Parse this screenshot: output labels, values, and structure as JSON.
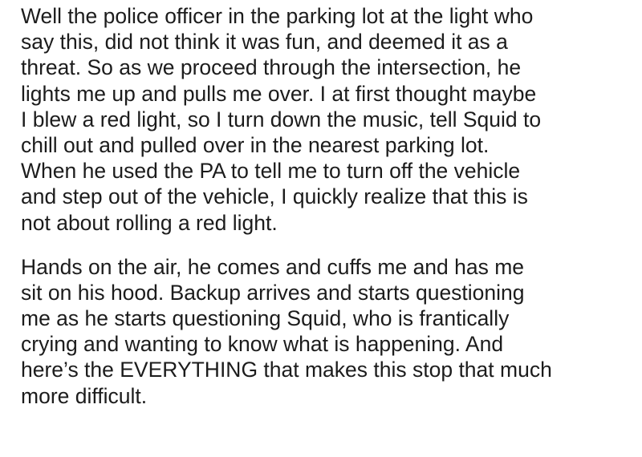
{
  "paragraphs": [
    {
      "lines": [
        "Well the police officer in the parking lot at the light who",
        "say this, did not think it was fun, and deemed it as a",
        "threat. So as we proceed through the intersection, he",
        "lights me up and pulls me over. I at first thought maybe",
        "I blew a red light, so I turn down the music, tell Squid to",
        "chill out and pulled over in the nearest parking lot.",
        "When he used the PA to tell me to turn off the vehicle",
        "and step out of the vehicle, I quickly realize that this is",
        "not about rolling a red light."
      ]
    },
    {
      "lines": [
        "Hands on the air, he comes and cuffs me and has me",
        "sit on his hood. Backup arrives and starts questioning",
        "me as he starts questioning Squid, who is frantically",
        "crying and wanting to know what is happening. And",
        "here’s the EVERYTHING that makes this stop that much",
        "more difficult."
      ]
    }
  ]
}
